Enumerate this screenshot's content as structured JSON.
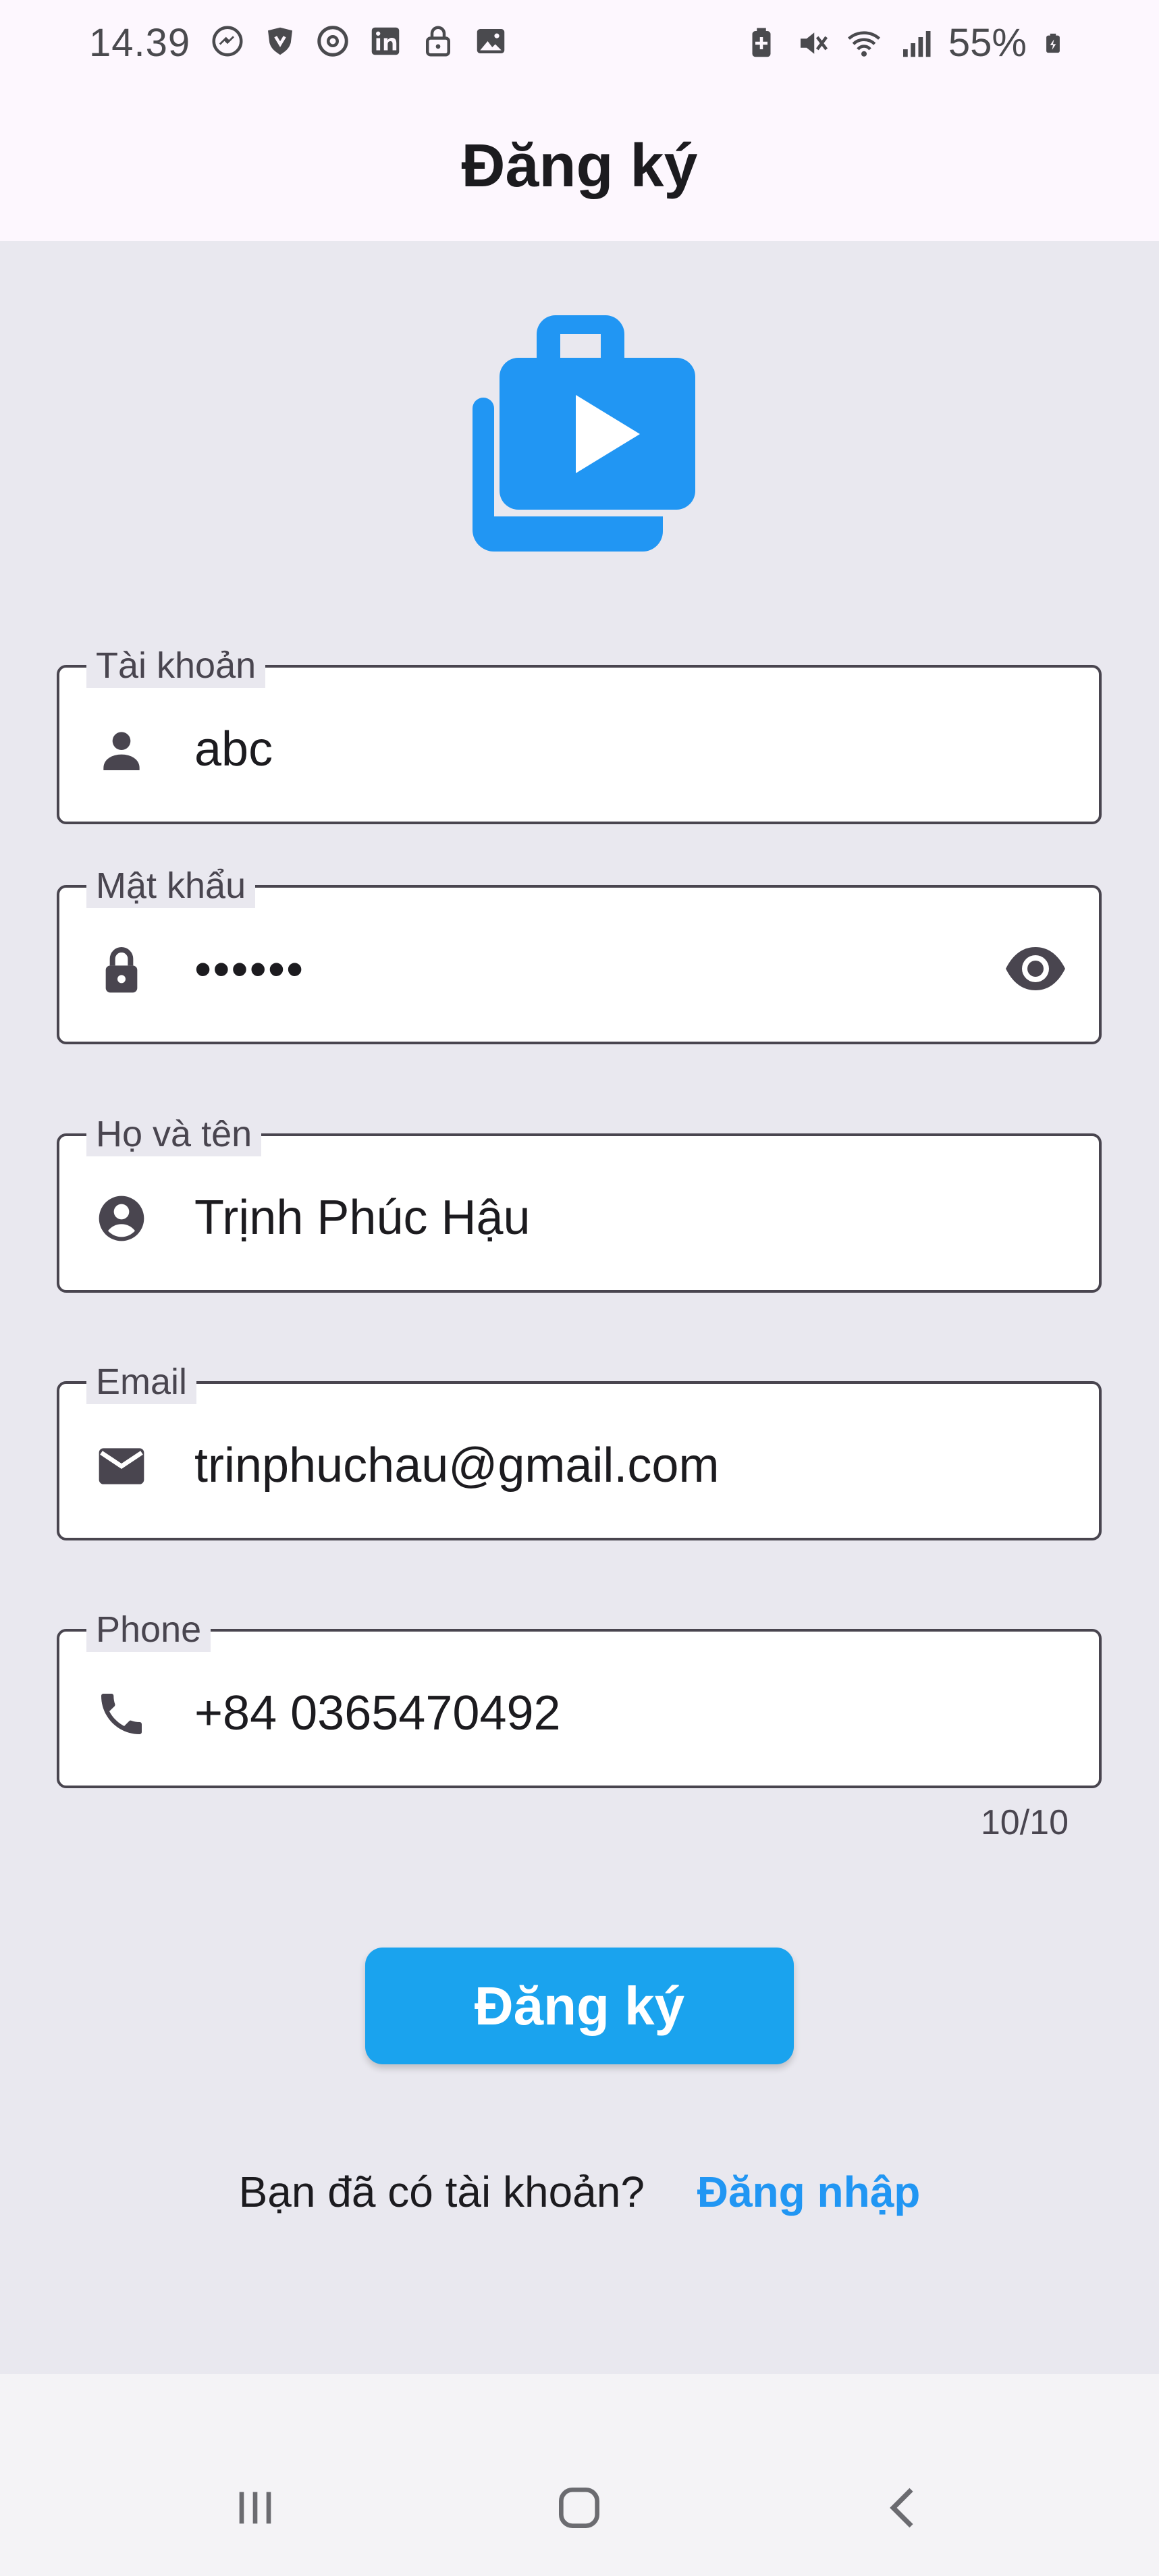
{
  "status_bar": {
    "time": "14.39",
    "battery": "55%",
    "left_icons": [
      "messenger-icon",
      "shield-icon",
      "threads-icon",
      "linkedin-icon",
      "lock-icon",
      "image-icon"
    ],
    "right_icons": [
      "battery-saver-icon",
      "mute-icon",
      "wifi-icon",
      "signal-icon",
      "battery-icon"
    ]
  },
  "app_bar": {
    "title": "Đăng ký"
  },
  "form": {
    "username": {
      "label": "Tài khoản",
      "value": "abc",
      "icon": "person-icon"
    },
    "password": {
      "label": "Mật khẩu",
      "value": "••••••",
      "icon": "lock-icon",
      "toggle_icon": "eye-icon"
    },
    "fullname": {
      "label": "Họ và tên",
      "value": "Trịnh Phúc Hậu",
      "icon": "account-circle-icon"
    },
    "email": {
      "label": "Email",
      "value": "trinphuchau@gmail.com",
      "icon": "mail-icon"
    },
    "phone": {
      "label": "Phone",
      "value": "+84 0365470492",
      "icon": "phone-icon",
      "counter": "10/10"
    },
    "submit_label": "Đăng ký",
    "login_prompt": "Bạn đã có tài khoản?",
    "login_link": "Đăng nhập"
  },
  "colors": {
    "accent": "#2196f3",
    "button": "#1aa3ee",
    "background": "#e9e8ef",
    "app_bar": "#fdf7fe"
  },
  "nav_bar": {
    "buttons": [
      "recent-apps-icon",
      "home-icon",
      "back-icon"
    ]
  }
}
